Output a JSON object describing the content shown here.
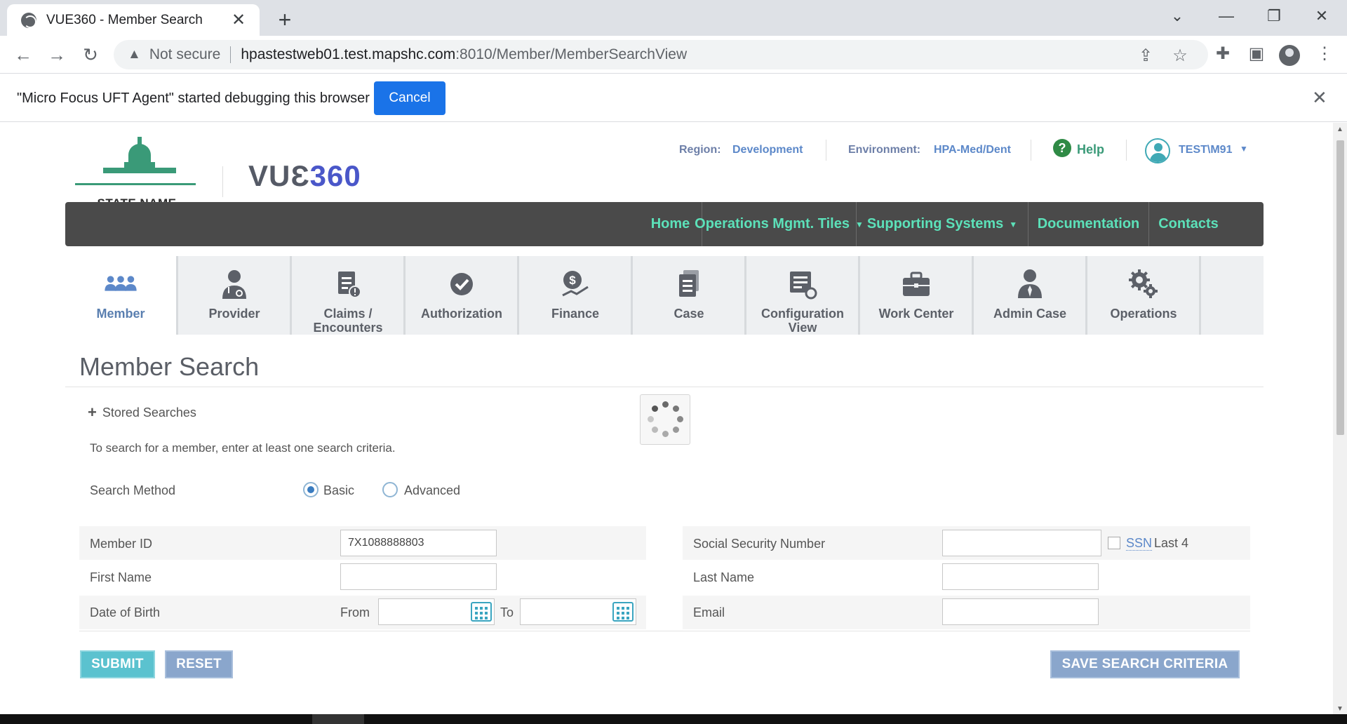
{
  "browser": {
    "tab_title": "VUE360 - Member Search",
    "url_warning": "Not secure",
    "url_host": "hpastestweb01.test.mapshc.com",
    "url_path": ":8010/Member/MemberSearchView",
    "infobar_text": "\"Micro Focus UFT Agent\" started debugging this browser",
    "infobar_cancel": "Cancel"
  },
  "header": {
    "state_name": "STATE NAME",
    "logo_left": "VUƐ",
    "logo_right": "360",
    "region_label": "Region:",
    "region_value": "Development",
    "environment_label": "Environment:",
    "environment_value": "HPA-Med/Dent",
    "help_label": "Help",
    "user_name": "TEST\\M91"
  },
  "topnav": {
    "items": [
      "Home",
      "Operations Mgmt. Tiles",
      "Supporting Systems",
      "Documentation",
      "Contacts"
    ]
  },
  "tiles": [
    {
      "label": "Member",
      "icon": "members-icon"
    },
    {
      "label": "Provider",
      "icon": "provider-icon"
    },
    {
      "label": "Claims / Encounters",
      "icon": "claims-icon"
    },
    {
      "label": "Authorization",
      "icon": "checkmark-icon"
    },
    {
      "label": "Finance",
      "icon": "finance-icon"
    },
    {
      "label": "Case",
      "icon": "case-icon"
    },
    {
      "label": "Configuration View",
      "icon": "configuration-icon"
    },
    {
      "label": "Work Center",
      "icon": "briefcase-icon"
    },
    {
      "label": "Admin Case",
      "icon": "admin-icon"
    },
    {
      "label": "Operations",
      "icon": "gears-icon"
    }
  ],
  "page": {
    "title": "Member Search",
    "stored_searches": "Stored Searches",
    "instructions": "To search for a member, enter at least one search criteria.",
    "search_method_label": "Search Method",
    "search_method_options": [
      "Basic",
      "Advanced"
    ],
    "search_method_selected": "Basic"
  },
  "form": {
    "member_id_label": "Member ID",
    "member_id_value": "7X1088888803",
    "ssn_label": "Social Security Number",
    "ssn_value": "",
    "ssn_link": "SSN",
    "ssn_last4": "Last 4",
    "first_name_label": "First Name",
    "last_name_label": "Last Name",
    "dob_label": "Date of Birth",
    "dob_from_label": "From",
    "dob_to_label": "To",
    "email_label": "Email"
  },
  "buttons": {
    "submit": "SUBMIT",
    "reset": "RESET",
    "save_criteria": "SAVE SEARCH CRITERIA"
  }
}
